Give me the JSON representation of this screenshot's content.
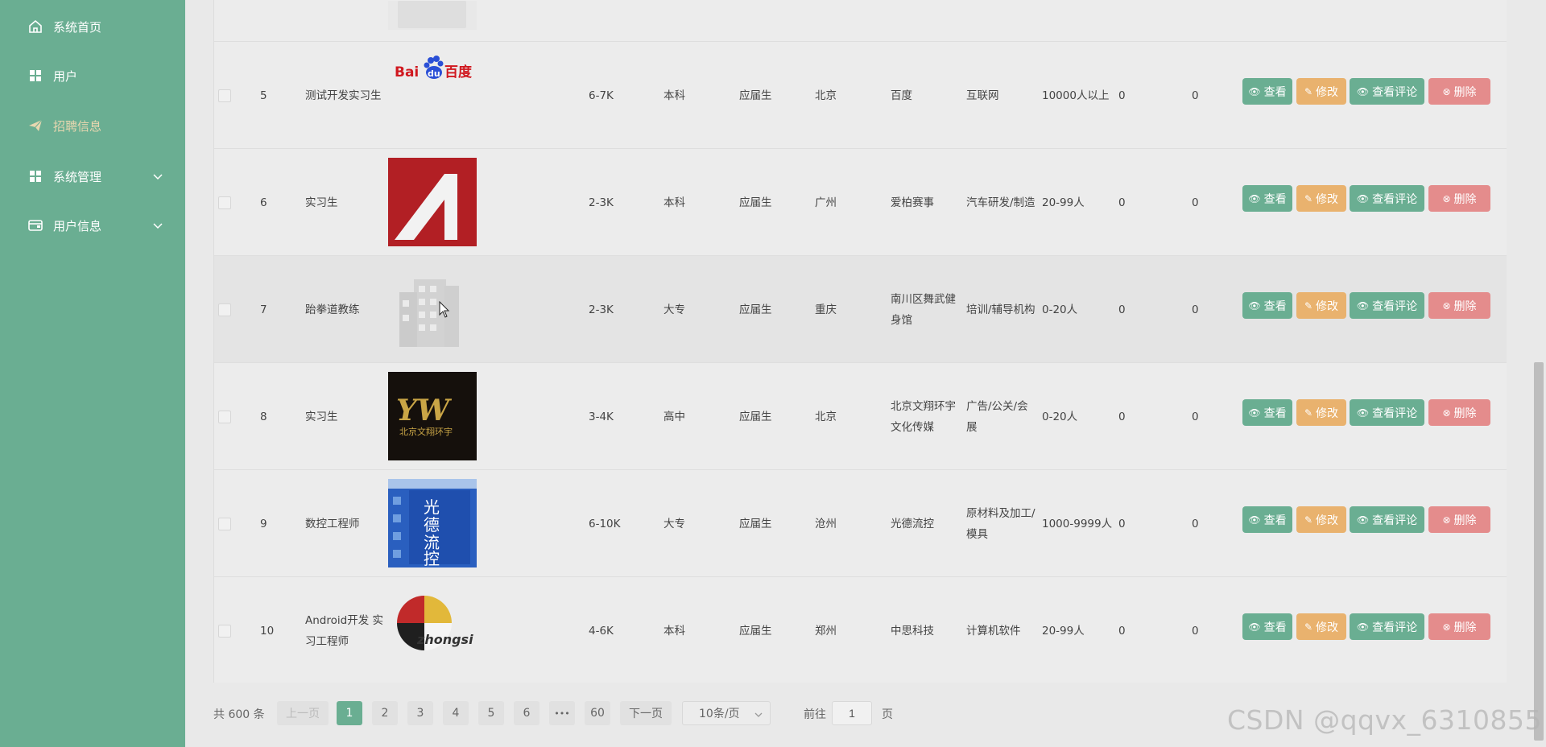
{
  "sidebar": {
    "items": [
      {
        "label": "系统首页",
        "icon": "home-icon"
      },
      {
        "label": "用户",
        "icon": "grid-icon"
      },
      {
        "label": "招聘信息",
        "icon": "paper-plane-icon",
        "active": true
      },
      {
        "label": "系统管理",
        "icon": "grid-icon",
        "expandable": true
      },
      {
        "label": "用户信息",
        "icon": "wallet-icon",
        "expandable": true
      }
    ]
  },
  "rows": [
    {
      "index": "5",
      "title": "测试开发实习生",
      "logo": "baidu",
      "salary": "6-7K",
      "education": "本科",
      "experience": "应届生",
      "city": "北京",
      "company": "百度",
      "industry": "互联网",
      "size": "10000人以上",
      "stat1": "0",
      "stat2": "0"
    },
    {
      "index": "6",
      "title": "实习生",
      "logo": "red-a",
      "salary": "2-3K",
      "education": "本科",
      "experience": "应届生",
      "city": "广州",
      "company": "爱柏赛事",
      "industry": "汽车研发/制造",
      "size": "20-99人",
      "stat1": "0",
      "stat2": "0"
    },
    {
      "index": "7",
      "title": "跆拳道教练",
      "logo": "building",
      "salary": "2-3K",
      "education": "大专",
      "experience": "应届生",
      "city": "重庆",
      "company": "南川区舞武健身馆",
      "industry": "培训/辅导机构",
      "size": "0-20人",
      "stat1": "0",
      "stat2": "0"
    },
    {
      "index": "8",
      "title": "实习生",
      "logo": "yw",
      "salary": "3-4K",
      "education": "高中",
      "experience": "应届生",
      "city": "北京",
      "company": "北京文翔环宇文化传媒",
      "industry": "广告/公关/会展",
      "size": "0-20人",
      "stat1": "0",
      "stat2": "0"
    },
    {
      "index": "9",
      "title": "数控工程师",
      "logo": "gdlk",
      "salary": "6-10K",
      "education": "大专",
      "experience": "应届生",
      "city": "沧州",
      "company": "光德流控",
      "industry": "原材料及加工/模具",
      "size": "1000-9999人",
      "stat1": "0",
      "stat2": "0"
    },
    {
      "index": "10",
      "title": "Android开发 实习工程师",
      "logo": "zhongsi",
      "salary": "4-6K",
      "education": "本科",
      "experience": "应届生",
      "city": "郑州",
      "company": "中思科技",
      "industry": "计算机软件",
      "size": "20-99人",
      "stat1": "0",
      "stat2": "0"
    }
  ],
  "actions": {
    "view": "查看",
    "edit": "修改",
    "comment": "查看评论",
    "delete": "删除"
  },
  "logos": {
    "baidu": {
      "bai": "Bai",
      "du": "du",
      "cn": "百度"
    },
    "yw": {
      "mark": "YW",
      "sub": "北京文翔环宇"
    },
    "gdlk": {
      "chars": [
        "光",
        "德",
        "流",
        "控"
      ]
    },
    "zhongsi": {
      "text": "zhongsi"
    }
  },
  "pagination": {
    "total": "共 600 条",
    "prev": "上一页",
    "pages": [
      "1",
      "2",
      "3",
      "4",
      "5",
      "6",
      "•••",
      "60"
    ],
    "current": "1",
    "next": "下一页",
    "page_size": "10条/页",
    "goto_label": "前往",
    "goto_value": "1",
    "goto_suffix": "页"
  },
  "watermark": "CSDN @qqvx_6310855",
  "colors": {
    "primary": "#6aae92",
    "edit": "#e9b26e",
    "delete": "#e48c8c",
    "sidebar": "#6aae92"
  }
}
